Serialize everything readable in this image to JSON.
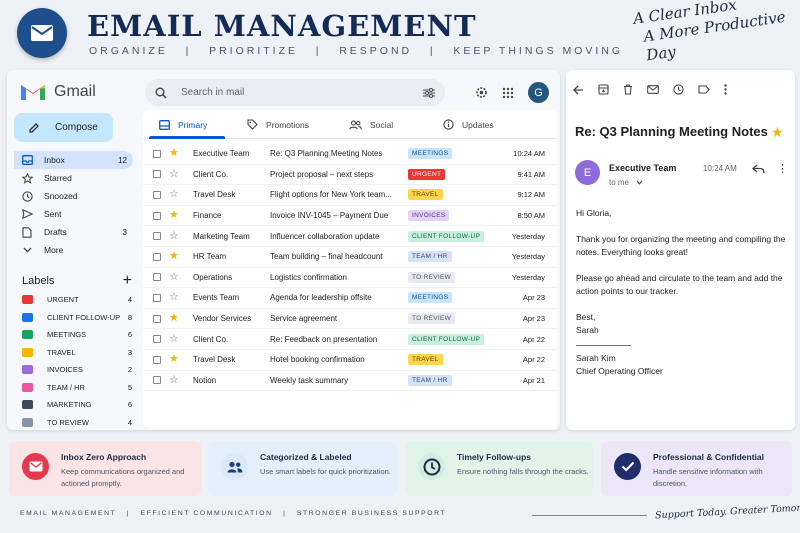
{
  "hero": {
    "title": "EMAIL MANAGEMENT",
    "subtitle": "ORGANIZE   |   PRIORITIZE   |   RESPOND   |   KEEP THINGS MOVING",
    "quote_line1": "A Clear Inbox",
    "quote_line2": "A More Productive Day"
  },
  "gmail": {
    "brand": "Gmail",
    "search_placeholder": "Search in mail",
    "avatar_letter": "G",
    "compose_label": "Compose",
    "nav": [
      {
        "label": "Inbox",
        "count": "12",
        "icon": "inbox-icon"
      },
      {
        "label": "Starred",
        "count": "",
        "icon": "star-icon"
      },
      {
        "label": "Snoozed",
        "count": "",
        "icon": "clock-icon"
      },
      {
        "label": "Sent",
        "count": "",
        "icon": "send-icon"
      },
      {
        "label": "Drafts",
        "count": "3",
        "icon": "draft-icon"
      },
      {
        "label": "More",
        "count": "",
        "icon": "chevron-down-icon"
      }
    ],
    "labels_title": "Labels",
    "labels": [
      {
        "name": "URGENT",
        "count": "4",
        "color": "#e53935"
      },
      {
        "name": "CLIENT FOLLOW-UP",
        "count": "8",
        "color": "#1e73e8"
      },
      {
        "name": "MEETINGS",
        "count": "6",
        "color": "#1aa260"
      },
      {
        "name": "TRAVEL",
        "count": "3",
        "color": "#f4b400"
      },
      {
        "name": "INVOICES",
        "count": "2",
        "color": "#9c6ade"
      },
      {
        "name": "TEAM / HR",
        "count": "5",
        "color": "#e8599b"
      },
      {
        "name": "MARKETING",
        "count": "6",
        "color": "#3c4a5a"
      },
      {
        "name": "TO REVIEW",
        "count": "4",
        "color": "#8a93a6"
      }
    ],
    "tabs": [
      {
        "label": "Primary",
        "icon": "inbox-tab-icon"
      },
      {
        "label": "Promotions",
        "icon": "tag-icon"
      },
      {
        "label": "Social",
        "icon": "people-icon"
      },
      {
        "label": "Updates",
        "icon": "info-icon"
      }
    ],
    "emails": [
      {
        "sender": "Executive Team",
        "subject": "Re: Q3 Planning Meeting Notes",
        "tag": "MEETINGS",
        "date": "10:24 AM",
        "starred": true
      },
      {
        "sender": "Client Co.",
        "subject": "Project proposal – next steps",
        "tag": "URGENT",
        "date": "9:41 AM",
        "starred": false
      },
      {
        "sender": "Travel Desk",
        "subject": "Flight options for New York team...",
        "tag": "TRAVEL",
        "date": "9:12 AM",
        "starred": false
      },
      {
        "sender": "Finance",
        "subject": "Invoice INV-1045 – Payment Due",
        "tag": "INVOICES",
        "date": "8:50 AM",
        "starred": true
      },
      {
        "sender": "Marketing Team",
        "subject": "Influencer collaboration update",
        "tag": "CLIENT FOLLOW-UP",
        "date": "Yesterday",
        "starred": false
      },
      {
        "sender": "HR Team",
        "subject": "Team building – final headcount",
        "tag": "TEAM / HR",
        "date": "Yesterday",
        "starred": true
      },
      {
        "sender": "Operations",
        "subject": "Logistics confirmation",
        "tag": "TO REVIEW",
        "date": "Yesterday",
        "starred": false
      },
      {
        "sender": "Events Team",
        "subject": "Agenda for leadership offsite",
        "tag": "MEETINGS",
        "date": "Apr 23",
        "starred": false
      },
      {
        "sender": "Vendor Services",
        "subject": "Service agreement",
        "tag": "TO REVIEW",
        "date": "Apr 23",
        "starred": true
      },
      {
        "sender": "Client Co.",
        "subject": "Re: Feedback on presentation",
        "tag": "CLIENT FOLLOW-UP",
        "date": "Apr 22",
        "starred": false
      },
      {
        "sender": "Travel Desk",
        "subject": "Hotel booking confirmation",
        "tag": "TRAVEL",
        "date": "Apr 22",
        "starred": true
      },
      {
        "sender": "Notion",
        "subject": "Weekly task summary",
        "tag": "TEAM / HR",
        "date": "Apr 21",
        "starred": false
      }
    ],
    "tag_colors": {
      "MEETINGS": {
        "bg": "#c9e4ff",
        "fg": "#1a4f8a"
      },
      "URGENT": {
        "bg": "#e53935",
        "fg": "#ffffff"
      },
      "TRAVEL": {
        "bg": "#ffd54f",
        "fg": "#5a4300"
      },
      "INVOICES": {
        "bg": "#e1d3f7",
        "fg": "#5b3b94"
      },
      "CLIENT FOLLOW-UP": {
        "bg": "#c8f0dc",
        "fg": "#116c43"
      },
      "TEAM / HR": {
        "bg": "#d7e3f4",
        "fg": "#2c4a75"
      },
      "TO REVIEW": {
        "bg": "#e6e9ef",
        "fg": "#4a5568"
      }
    }
  },
  "reader": {
    "subject": "Re: Q3 Planning Meeting Notes",
    "avatar_letter": "E",
    "from": "Executive Team",
    "to": "to me",
    "time": "10:24 AM",
    "greeting": "Hi Gloria,",
    "para1": "Thank you for organizing the meeting and compiling the notes. Everything looks great!",
    "para2": "Please go ahead and circulate to the team and add the action points to our tracker.",
    "signoff": "Best,",
    "signoff_name": "Sarah",
    "sig_name": "Sarah Kim",
    "sig_title": "Chief Operating Officer"
  },
  "cards": [
    {
      "title": "Inbox Zero Approach",
      "desc": "Keep communications organized and actioned promptly.",
      "bg": "#fbe4e6",
      "icon_bg": "#e53950",
      "icon": "mail-icon"
    },
    {
      "title": "Categorized & Labeled",
      "desc": "Use smart labels for quick prioritization.",
      "bg": "#e3effb",
      "icon_bg": "#dbe8f8",
      "icon": "people-icon"
    },
    {
      "title": "Timely Follow-ups",
      "desc": "Ensure nothing falls through the cracks.",
      "bg": "#e2f4ea",
      "icon_bg": "#d3ecdd",
      "icon": "clock-icon"
    },
    {
      "title": "Professional & Confidential",
      "desc": "Handle sensitive information with discretion.",
      "bg": "#ece6f8",
      "icon_bg": "#1f2d6b",
      "icon": "check-icon"
    }
  ],
  "footer": {
    "left": "EMAIL MANAGEMENT   |   EFFICIENT COMMUNICATION   |   STRONGER BUSINESS SUPPORT",
    "right": "Support Today. Greater Tomorrow."
  }
}
